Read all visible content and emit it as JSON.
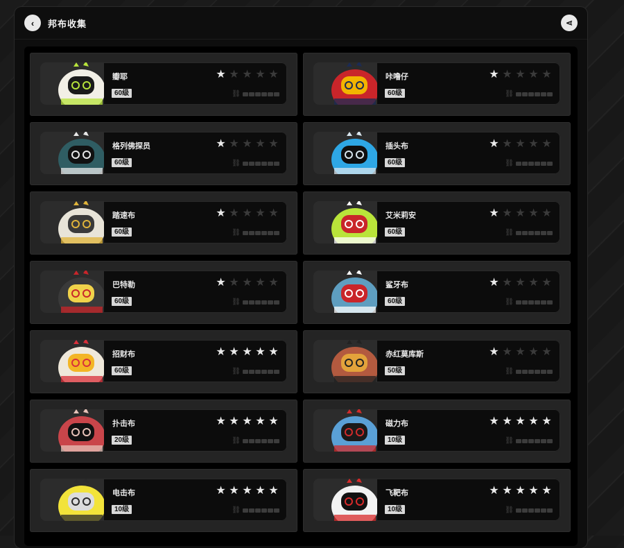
{
  "header": {
    "title": "邦布收集",
    "back_icon": "chevron-left-icon",
    "share_icon": "share-icon"
  },
  "colors": {
    "accent": "#e9e9e9",
    "background": "#0e0e0e",
    "card": "#242424"
  },
  "cards": [
    {
      "name": "瓣耶",
      "level": "60级",
      "stars": 1,
      "colors": [
        "#f2efe6",
        "#b7e33b",
        "#1a1a1a"
      ]
    },
    {
      "name": "咔噜仔",
      "level": "60级",
      "stars": 1,
      "colors": [
        "#c9252a",
        "#1b2b55",
        "#f2b400"
      ]
    },
    {
      "name": "格列佛探员",
      "level": "60级",
      "stars": 1,
      "colors": [
        "#2f5d63",
        "#e8e8e8",
        "#111111"
      ]
    },
    {
      "name": "插头布",
      "level": "60级",
      "stars": 1,
      "colors": [
        "#2ea7e5",
        "#d9e6ee",
        "#0f0f0f"
      ]
    },
    {
      "name": "踏速布",
      "level": "60级",
      "stars": 1,
      "colors": [
        "#e8e4d8",
        "#e0b43a",
        "#3a3a3a"
      ]
    },
    {
      "name": "艾米莉安",
      "level": "60级",
      "stars": 1,
      "colors": [
        "#b9e43a",
        "#ffffff",
        "#c9252a"
      ]
    },
    {
      "name": "巴特勒",
      "level": "60级",
      "stars": 1,
      "colors": [
        "#3a3a3a",
        "#c9252a",
        "#f0d24a"
      ]
    },
    {
      "name": "鲨牙布",
      "level": "60级",
      "stars": 1,
      "colors": [
        "#5e9ec0",
        "#ffffff",
        "#c9252a"
      ]
    },
    {
      "name": "招财布",
      "level": "60级",
      "stars": 5,
      "colors": [
        "#efe8da",
        "#d9303a",
        "#f3b525"
      ]
    },
    {
      "name": "赤红莫库斯",
      "level": "50级",
      "stars": 1,
      "colors": [
        "#b35a3f",
        "#222222",
        "#e3a33b"
      ]
    },
    {
      "name": "扑击布",
      "level": "20级",
      "stars": 5,
      "colors": [
        "#c9454a",
        "#e6c2b8",
        "#111111"
      ]
    },
    {
      "name": "磁力布",
      "level": "10级",
      "stars": 5,
      "colors": [
        "#5aa0d6",
        "#d02b2b",
        "#1a1a1a"
      ]
    },
    {
      "name": "电击布",
      "level": "10级",
      "stars": 5,
      "colors": [
        "#f2e33a",
        "#2a2a2a",
        "#dcdcdc"
      ]
    },
    {
      "name": "飞靶布",
      "level": "10级",
      "stars": 5,
      "colors": [
        "#f2f2f2",
        "#d82a2a",
        "#111111"
      ]
    }
  ],
  "star_icon": "star-icon",
  "progress_icon": "link-icon"
}
